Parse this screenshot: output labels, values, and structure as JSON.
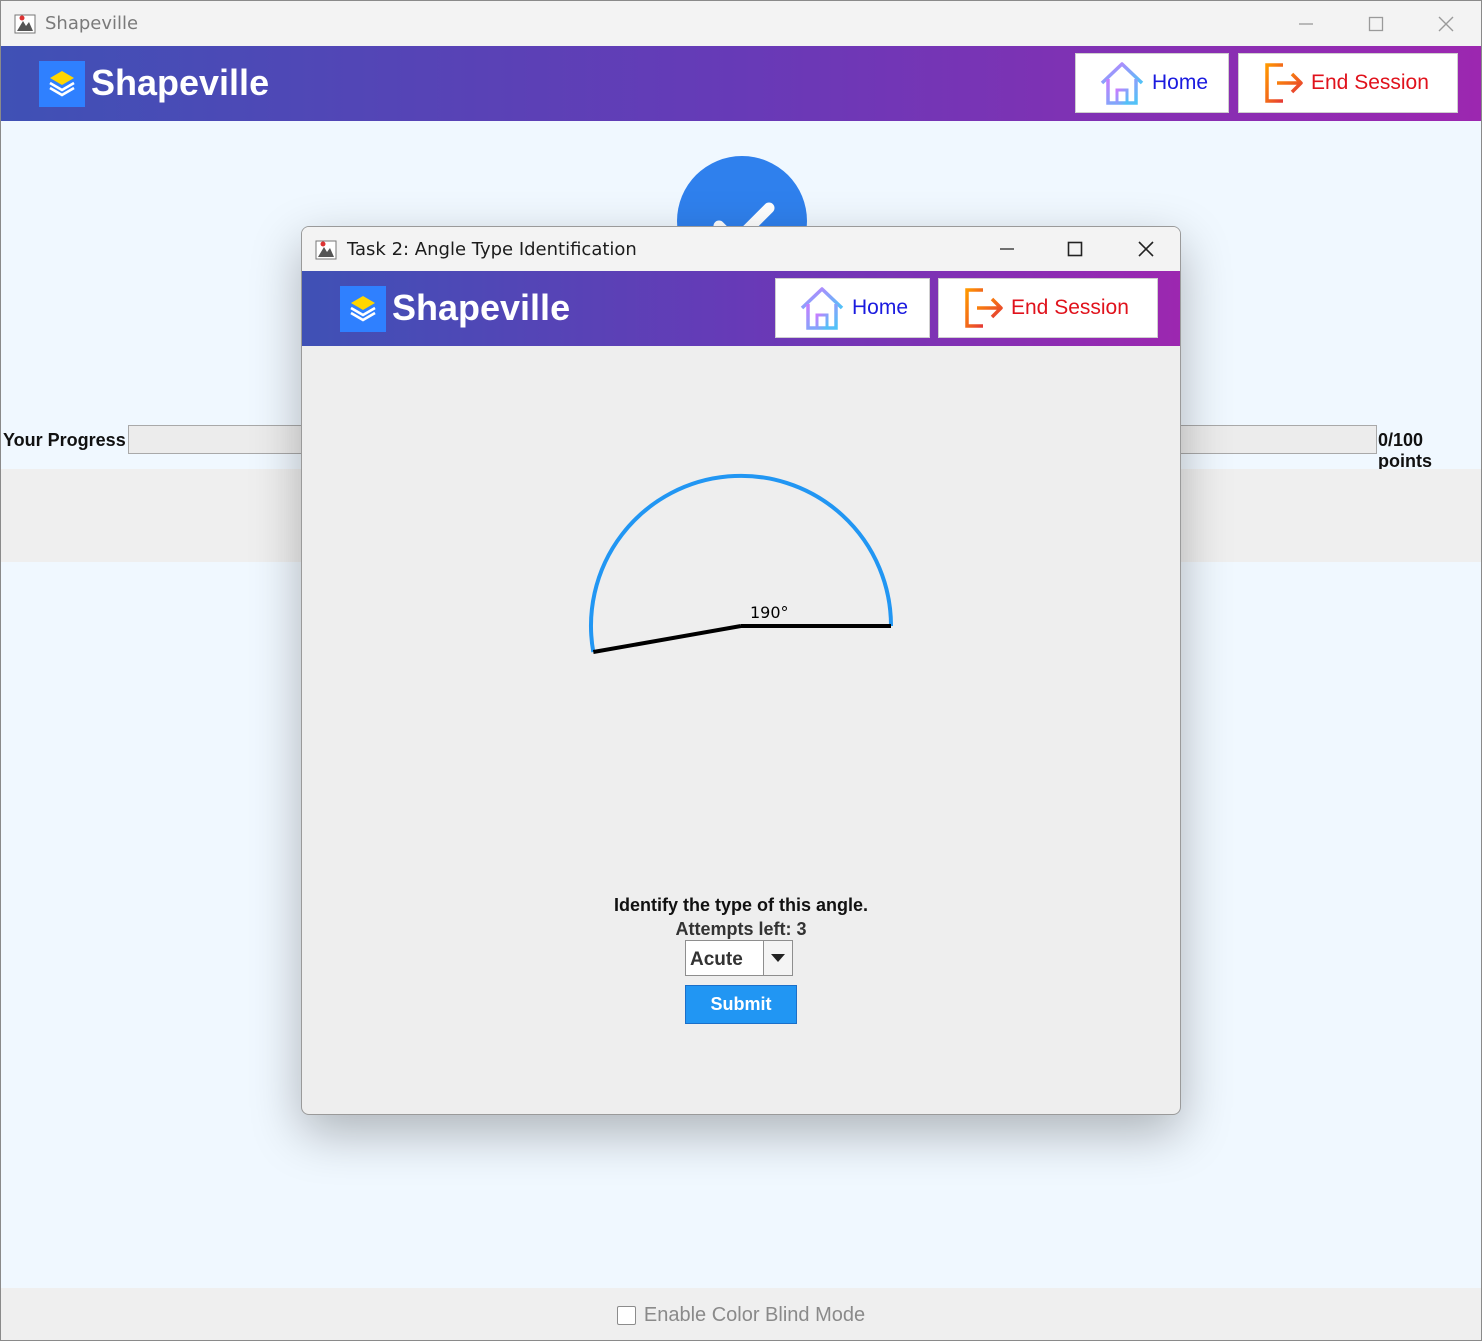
{
  "main_window": {
    "title": "Shapeville",
    "header": {
      "brand": "Shapeville",
      "home_label": "Home",
      "end_session_label": "End Session"
    },
    "progress": {
      "label": "Your Progress",
      "text": "0/100 points",
      "fraction": 0
    },
    "footer": {
      "color_blind_label": "Enable Color Blind Mode",
      "color_blind_checked": false
    }
  },
  "dialog": {
    "title": "Task 2: Angle Type Identification",
    "header": {
      "brand": "Shapeville",
      "home_label": "Home",
      "end_session_label": "End Session"
    },
    "angle": {
      "degrees": 190,
      "label": "190°"
    },
    "question": "Identify the type of this angle.",
    "attempts": "Attempts left: 3",
    "selected_type": "Acute",
    "submit_label": "Submit"
  },
  "colors": {
    "header_gradient_start": "#3f51b5",
    "header_gradient_end": "#9c27b0",
    "arc": "#2196f3",
    "submit": "#2196f3",
    "home_text": "#1a1adf",
    "end_session_text": "#e0121c"
  },
  "icons": {
    "app": "java-app-icon",
    "logo": "layers-icon",
    "home": "home-icon",
    "end_session": "logout-icon",
    "check": "checkmark-icon",
    "dropdown": "triangle-down-icon"
  }
}
